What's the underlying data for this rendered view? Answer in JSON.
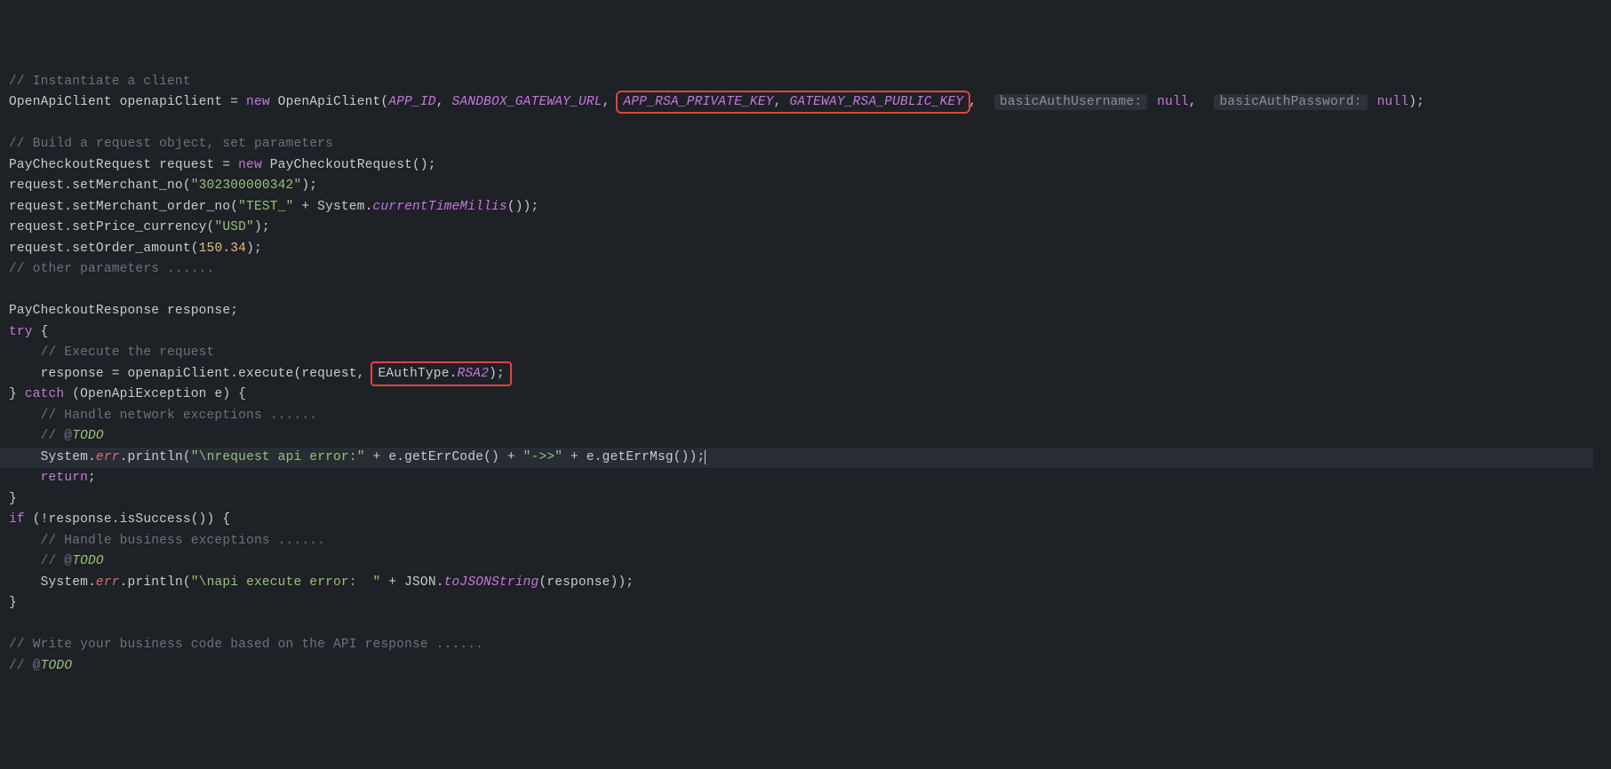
{
  "code": {
    "c1": "// Instantiate a client",
    "l2a": "OpenApiClient openapiClient = ",
    "l2new": "new",
    "l2b": " OpenApiClient(",
    "l2_app": "APP_ID",
    "l2c": ", ",
    "l2_sand": "SANDBOX_GATEWAY_URL",
    "l2d": ",",
    "l2_priv": "APP_RSA_PRIVATE_KEY",
    "l2e": ", ",
    "l2_pub": "GATEWAY_RSA_PUBLIC_KEY",
    "l2f": ", ",
    "l2_hint1": "basicAuthUsername:",
    "l2_null1": "null",
    "l2g": ", ",
    "l2_hint2": "basicAuthPassword:",
    "l2_null2": "null",
    "l2h": ");",
    "c3": "// Build a request object, set parameters",
    "l4a": "PayCheckoutRequest request = ",
    "l4new": "new",
    "l4b": " PayCheckoutRequest();",
    "l5a": "request.setMerchant_no(",
    "l5s": "\"302300000342\"",
    "l5b": ");",
    "l6a": "request.setMerchant_order_no(",
    "l6s": "\"TEST_\"",
    "l6b": " + System.",
    "l6m": "currentTimeMillis",
    "l6c": "());",
    "l7a": "request.setPrice_currency(",
    "l7s": "\"USD\"",
    "l7b": ");",
    "l8a": "request.setOrder_amount(",
    "l8n": "150.34",
    "l8b": ");",
    "c9": "// other parameters ......",
    "l10": "PayCheckoutResponse response;",
    "l11a": "try",
    "l11b": " {",
    "c12": "    // Execute the request",
    "l13a": "    response = openapiClient.execute(request,",
    "l13b": "EAuthType.",
    "l13c": "RSA2",
    "l13d": ");",
    "l14a": "} ",
    "l14catch": "catch",
    "l14b": " (OpenApiException e) {",
    "c15": "    // Handle network exceptions ......",
    "c16a": "    // @",
    "c16b": "TODO",
    "l17a": "    System.",
    "l17err": "err",
    "l17b": ".println(",
    "l17s1": "\"\\nrequest api error:\"",
    "l17c": " + e.getErrCode() + ",
    "l17s2": "\"->>\"",
    "l17d": " + e.getErrMsg());",
    "l18a": "    ",
    "l18ret": "return",
    "l18b": ";",
    "l19": "}",
    "l20a": "if",
    "l20b": " (!response.isSuccess()) {",
    "c21": "    // Handle business exceptions ......",
    "c22a": "    // @",
    "c22b": "TODO",
    "l23a": "    System.",
    "l23err": "err",
    "l23b": ".println(",
    "l23s": "\"\\napi execute error:  \"",
    "l23c": " + JSON.",
    "l23m": "toJSONString",
    "l23d": "(response));",
    "l24": "}",
    "c25": "// Write your business code based on the API response ......",
    "c26a": "// @",
    "c26b": "TODO"
  },
  "highlights": {
    "box1_desc": "APP_RSA_PRIVATE_KEY, GATEWAY_RSA_PUBLIC_KEY",
    "box2_desc": "EAuthType.RSA2"
  }
}
